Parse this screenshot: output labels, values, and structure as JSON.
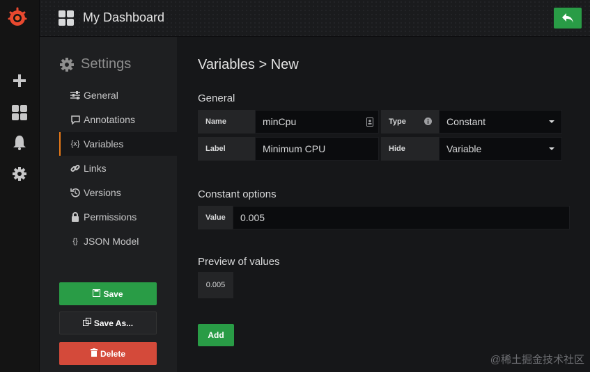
{
  "sidemenu": {
    "icons": [
      "grafana-logo-icon",
      "plus-icon",
      "dashboards-icon",
      "bell-icon",
      "gear-icon"
    ]
  },
  "navbar": {
    "title": "My Dashboard",
    "back_icon": "back-arrow-icon",
    "colors": {
      "back_button": "#299c46"
    }
  },
  "settings": {
    "heading": "Settings",
    "items": [
      {
        "label": "General",
        "icon": "sliders-icon"
      },
      {
        "label": "Annotations",
        "icon": "comment-icon"
      },
      {
        "label": "Variables",
        "icon": "variable-icon",
        "icon_text": "{x}",
        "active": true
      },
      {
        "label": "Links",
        "icon": "link-icon"
      },
      {
        "label": "Versions",
        "icon": "history-icon"
      },
      {
        "label": "Permissions",
        "icon": "lock-icon"
      },
      {
        "label": "JSON Model",
        "icon": "json-icon",
        "icon_text": "{}"
      }
    ],
    "save_label": "Save",
    "save_as_label": "Save As...",
    "delete_label": "Delete",
    "colors": {
      "active_border": "#eb7b18",
      "save": "#299c46",
      "delete": "#d44a3a"
    }
  },
  "main": {
    "title": "Variables > New",
    "general": {
      "title": "General",
      "name_label": "Name",
      "name_value": "minCpu",
      "type_label": "Type",
      "type_value": "Constant",
      "label_label": "Label",
      "label_value": "Minimum CPU",
      "hide_label": "Hide",
      "hide_value": "Variable"
    },
    "constant": {
      "title": "Constant options",
      "value_label": "Value",
      "value": "0.005"
    },
    "preview": {
      "title": "Preview of values",
      "values": [
        "0.005"
      ]
    },
    "add_label": "Add"
  },
  "watermark": "@稀土掘金技术社区"
}
